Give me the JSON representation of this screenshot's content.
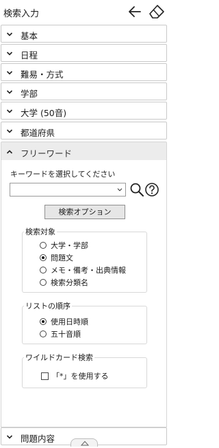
{
  "header": {
    "title": "検索入力"
  },
  "sections": [
    {
      "label": "基本"
    },
    {
      "label": "日程"
    },
    {
      "label": "難易・方式"
    },
    {
      "label": "学部"
    },
    {
      "label": "大学 (50音)"
    },
    {
      "label": "都道府県"
    },
    {
      "label": "フリーワード"
    }
  ],
  "freeword": {
    "keyword_label": "キーワードを選択してください",
    "select_value": "",
    "options_button": "検索オプション",
    "target": {
      "legend": "検索対象",
      "options": [
        "大学・学部",
        "問題文",
        "メモ・備考・出典情報",
        "検索分類名"
      ],
      "selected_index": 1
    },
    "order": {
      "legend": "リストの順序",
      "options": [
        "使用日時順",
        "五十音順"
      ],
      "selected_index": 0
    },
    "wildcard": {
      "legend": "ワイルドカード検索",
      "checkbox_label": "「*」を使用する",
      "checked": false
    }
  },
  "bottom_section": {
    "label": "問題内容"
  },
  "icons": {
    "back": "arrow-left-icon",
    "clear": "eraser-icon",
    "search": "search-icon",
    "help": "help-icon",
    "chevron": "chevron-down-icon"
  }
}
